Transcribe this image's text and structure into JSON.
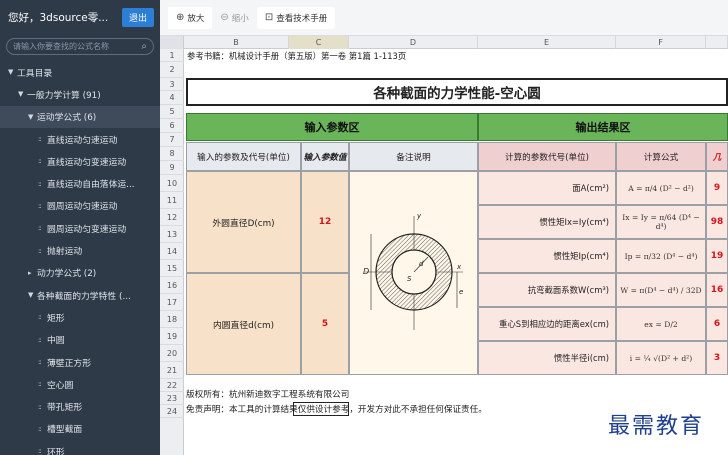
{
  "sidebar": {
    "greeting": "您好，3dsource零...",
    "logout": "退出",
    "search_placeholder": "请输入你要查找的公式名称",
    "items": [
      {
        "label": "工具目录",
        "level": 0,
        "mark": "▼"
      },
      {
        "label": "一般力学计算 (91)",
        "level": 1,
        "mark": "▼"
      },
      {
        "label": "运动学公式 (6)",
        "level": 2,
        "mark": "▼"
      },
      {
        "label": "直线运动匀速运动",
        "level": 3,
        "mark": "::"
      },
      {
        "label": "直线运动匀变速运动",
        "level": 3,
        "mark": "::"
      },
      {
        "label": "直线运动自由落体运...",
        "level": 3,
        "mark": "::"
      },
      {
        "label": "圆周运动匀速运动",
        "level": 3,
        "mark": "::"
      },
      {
        "label": "圆周运动匀变速运动",
        "level": 3,
        "mark": "::"
      },
      {
        "label": "抛射运动",
        "level": 3,
        "mark": "::"
      },
      {
        "label": "动力学公式 (2)",
        "level": 2,
        "mark": "▸"
      },
      {
        "label": "各种截面的力学特性 (...",
        "level": 2,
        "mark": "▼"
      },
      {
        "label": "矩形",
        "level": 3,
        "mark": "::"
      },
      {
        "label": "中圆",
        "level": 3,
        "mark": "::"
      },
      {
        "label": "薄壁正方形",
        "level": 3,
        "mark": "::"
      },
      {
        "label": "空心圆",
        "level": 3,
        "mark": "::"
      },
      {
        "label": "带孔矩形",
        "level": 3,
        "mark": "::"
      },
      {
        "label": "槽型截面",
        "level": 3,
        "mark": "::"
      },
      {
        "label": "环形",
        "level": 3,
        "mark": "::"
      }
    ]
  },
  "toolbar": {
    "zoom_in": "放大",
    "zoom_out": "缩小",
    "manual": "查看技术手册"
  },
  "sheet": {
    "columns": [
      "B",
      "C",
      "D",
      "E",
      "F",
      ""
    ],
    "rows": [
      "1",
      "2",
      "3",
      "4",
      "5",
      "6",
      "7",
      "8",
      "9",
      "10",
      "11",
      "12",
      "13",
      "14",
      "15",
      "16",
      "17",
      "18",
      "19",
      "20",
      "21",
      "22",
      "23",
      "24"
    ],
    "reference": "参考书籍：机械设计手册（第五版）第一卷 第1篇 1-113页",
    "title": "各种截面的力学性能-空心圆",
    "input_band": "输入参数区",
    "output_band": "输出结果区",
    "headers": {
      "in_param": "输入的参数及代号(单位)",
      "in_value": "输入参数值",
      "in_note": "备注说明",
      "out_param": "计算的参数代号(单位)",
      "out_formula": "计算公式",
      "out_value": "几"
    },
    "inputs": [
      {
        "label": "外圆直径D(cm)",
        "value": "12"
      },
      {
        "label": "内圆直径d(cm)",
        "value": "5"
      }
    ],
    "outputs": [
      {
        "label": "面A(cm²)",
        "formula": "A = π/4 (D² − d²)",
        "value": "9"
      },
      {
        "label": "惯性矩Ix=Iy(cm⁴)",
        "formula": "Ix = Iy = π/64 (D⁴ − d⁴)",
        "value": "98"
      },
      {
        "label": "惯性矩Ip(cm⁴)",
        "formula": "Ip = π/32 (D⁴ − d⁴)",
        "value": "19"
      },
      {
        "label": "抗弯截面系数W(cm³)",
        "formula": "W = π(D⁴ − d⁴) / 32D",
        "value": "16"
      },
      {
        "label": "重心S到相应边的距离ex(cm)",
        "formula": "ex = D/2",
        "value": "6"
      },
      {
        "label": "惯性半径i(cm)",
        "formula": "i = ¼ √(D² + d²)",
        "value": "3"
      }
    ],
    "copyright": "版权所有：杭州新迪数字工程系统有限公司",
    "disclaimer_a": "免责声明：本工具的计算",
    "disclaimer_b": "结果仅供设计",
    "disclaimer_c": "参考，开发方对此不承担任何保证责任。",
    "brand": "最需教育"
  },
  "colors": {
    "sidebar": "#2f3a48",
    "band": "#6ab45a",
    "value": "#d4151a"
  }
}
